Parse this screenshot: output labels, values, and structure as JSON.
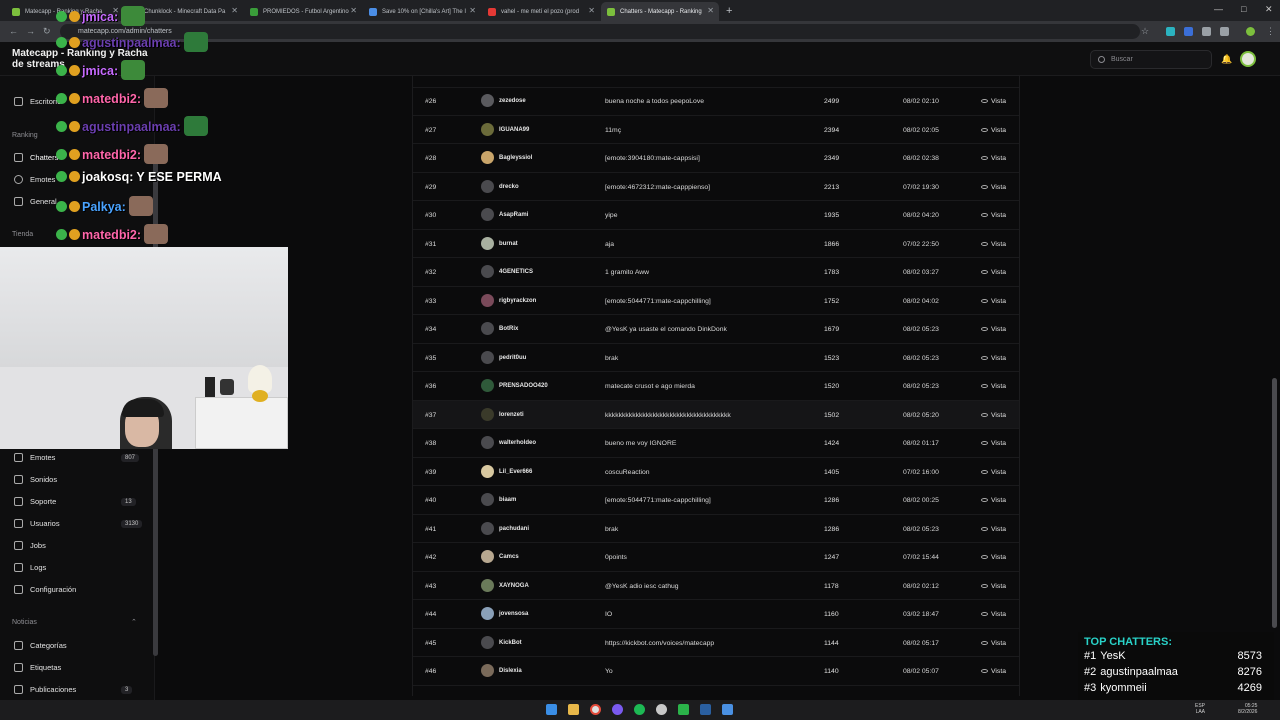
{
  "browser": {
    "tabs": [
      {
        "label": "Matecapp - Ranking y Racha",
        "color": "#7cbf3d",
        "active": false
      },
      {
        "label": "Chunklock - Minecraft Data Pa",
        "color": "#4caf50",
        "active": false
      },
      {
        "label": "PROMIEDOS - Futbol Argentino",
        "color": "#3a9d3a",
        "active": false
      },
      {
        "label": "Save 10% on [Chilla's Art] The I",
        "color": "#4b8ee6",
        "active": false
      },
      {
        "label": "vahel - me metí el pozo (prod",
        "color": "#e53935",
        "active": false
      },
      {
        "label": "Chatters - Matecapp - Ranking",
        "color": "#7cbf3d",
        "active": true
      }
    ],
    "new_tab": "+",
    "url": "matecapp.com/admin/chatters"
  },
  "header": {
    "brand": "Matecapp - Ranking y Racha de streams",
    "search_placeholder": "Buscar"
  },
  "sidebar": {
    "items_top": [
      {
        "label": "Escritorio",
        "name": "sidebar-item-escritorio"
      }
    ],
    "section_ranking": "Ranking",
    "items_ranking": [
      {
        "label": "Chatters",
        "name": "sidebar-item-chatters"
      },
      {
        "label": "Emotes",
        "name": "sidebar-item-emotes-ranking"
      },
      {
        "label": "General",
        "name": "sidebar-item-general"
      }
    ],
    "section_tienda": "Tienda",
    "items_admin": [
      {
        "label": "Emotes",
        "badge": "807",
        "name": "sidebar-item-emotes"
      },
      {
        "label": "Sonidos",
        "badge": "",
        "name": "sidebar-item-sonidos"
      },
      {
        "label": "Soporte",
        "badge": "13",
        "name": "sidebar-item-soporte"
      },
      {
        "label": "Usuarios",
        "badge": "3130",
        "name": "sidebar-item-usuarios"
      },
      {
        "label": "Jobs",
        "badge": "",
        "name": "sidebar-item-jobs"
      },
      {
        "label": "Logs",
        "badge": "",
        "name": "sidebar-item-logs"
      },
      {
        "label": "Configuración",
        "badge": "",
        "name": "sidebar-item-configuracion"
      }
    ],
    "section_noticias": "Noticias",
    "items_noticias": [
      {
        "label": "Categorías",
        "badge": "",
        "name": "sidebar-item-categorias"
      },
      {
        "label": "Etiquetas",
        "badge": "",
        "name": "sidebar-item-etiquetas"
      },
      {
        "label": "Publicaciones",
        "badge": "3",
        "name": "sidebar-item-publicaciones"
      }
    ]
  },
  "table": {
    "view_label": "Vista",
    "rows": [
      {
        "rank": "#26",
        "user": "zezedose",
        "msg": "buena noche a todos peepoLove",
        "count": "2499",
        "date": "08/02 02:10",
        "av": "#5a5a5e"
      },
      {
        "rank": "#27",
        "user": "IGUANA99",
        "msg": "11mç",
        "count": "2394",
        "date": "08/02 02:05",
        "av": "#6b6b3a"
      },
      {
        "rank": "#28",
        "user": "Bagleyssiol",
        "msg": "[emote:3904180:mate-cappsisi]",
        "count": "2349",
        "date": "08/02 02:38",
        "av": "#c9a56a"
      },
      {
        "rank": "#29",
        "user": "drecko",
        "msg": "[emote:4672312:mate-capppienso]",
        "count": "2213",
        "date": "07/02 19:30",
        "av": "#4a4a4e"
      },
      {
        "rank": "#30",
        "user": "AsapRami",
        "msg": "yipe",
        "count": "1935",
        "date": "08/02 04:20",
        "av": "#4a4a4e"
      },
      {
        "rank": "#31",
        "user": "burnat",
        "msg": "aja",
        "count": "1866",
        "date": "07/02 22:50",
        "av": "#a8b0a0"
      },
      {
        "rank": "#32",
        "user": "4GENETICS",
        "msg": "1 gramito Aww",
        "count": "1783",
        "date": "08/02 03:27",
        "av": "#4a4a4e"
      },
      {
        "rank": "#33",
        "user": "rigbyrackzon",
        "msg": "[emote:5044771:mate-cappchilling]",
        "count": "1752",
        "date": "08/02 04:02",
        "av": "#7a4a5a"
      },
      {
        "rank": "#34",
        "user": "BotRix",
        "msg": "@YesK ya usaste el comando DinkDonk",
        "count": "1679",
        "date": "08/02 05:23",
        "av": "#4a4a4e"
      },
      {
        "rank": "#35",
        "user": "pedrit0uu",
        "msg": "brak",
        "count": "1523",
        "date": "08/02 05:23",
        "av": "#4a4a4e"
      },
      {
        "rank": "#36",
        "user": "PRENSADOO420",
        "msg": "matecate crusot e ago mierda",
        "count": "1520",
        "date": "08/02 05:23",
        "av": "#2f5a3a"
      },
      {
        "rank": "#37",
        "user": "lorenzeti",
        "msg": "kkkkkkkkkkkkkkkkkkkkkkkkkkkkkkkkkkkkk",
        "count": "1502",
        "date": "08/02 05:20",
        "av": "#3a3a2a"
      },
      {
        "rank": "#38",
        "user": "walterholdeo",
        "msg": "bueno me voy IGNORE",
        "count": "1424",
        "date": "08/02 01:17",
        "av": "#4a4a4e"
      },
      {
        "rank": "#39",
        "user": "Lil_Ever666",
        "msg": "coscuReaction",
        "count": "1405",
        "date": "07/02 16:00",
        "av": "#d8c8a0"
      },
      {
        "rank": "#40",
        "user": "biaam",
        "msg": "[emote:5044771:mate-cappchilling]",
        "count": "1286",
        "date": "08/02 00:25",
        "av": "#4a4a4e"
      },
      {
        "rank": "#41",
        "user": "pachudani",
        "msg": "brak",
        "count": "1286",
        "date": "08/02 05:23",
        "av": "#4a4a4e"
      },
      {
        "rank": "#42",
        "user": "Camcs",
        "msg": "0points",
        "count": "1247",
        "date": "07/02 15:44",
        "av": "#b8a890"
      },
      {
        "rank": "#43",
        "user": "XAYNOGA",
        "msg": "@YesK adio iesc cathug",
        "count": "1178",
        "date": "08/02 02:12",
        "av": "#6a7a5a"
      },
      {
        "rank": "#44",
        "user": "jovensosa",
        "msg": "IO",
        "count": "1160",
        "date": "03/02 18:47",
        "av": "#8aa0b8"
      },
      {
        "rank": "#45",
        "user": "KickBot",
        "msg": "https://kickbot.com/voices/matecapp",
        "count": "1144",
        "date": "08/02 05:17",
        "av": "#4a4a4e"
      },
      {
        "rank": "#46",
        "user": "Dislexia",
        "msg": "Yo",
        "count": "1140",
        "date": "08/02 05:07",
        "av": "#7a6a5a"
      }
    ]
  },
  "overlay": {
    "chat": [
      {
        "user": "jmica",
        "text": "",
        "color": "#c76bff"
      },
      {
        "user": "agustinpaalmaa",
        "text": "",
        "color": "#6b3fb0"
      },
      {
        "user": "jmica",
        "text": "",
        "color": "#c76bff"
      },
      {
        "user": "matedbi2",
        "text": "",
        "color": "#ff66aa"
      },
      {
        "user": "agustinpaalmaa",
        "text": "",
        "color": "#6b3fb0"
      },
      {
        "user": "matedbi2",
        "text": "",
        "color": "#ff66aa"
      },
      {
        "user": "joakosq",
        "text": "Y ESE PERMA",
        "color": "#ffffff"
      },
      {
        "user": "Palkya",
        "text": "",
        "color": "#4aa3ff"
      },
      {
        "user": "matedbi2",
        "text": "",
        "color": "#ff66aa"
      }
    ],
    "top_chatters": {
      "title": "TOP CHATTERS:",
      "entries": [
        {
          "rank": "#1",
          "name": "YesK",
          "value": "8573"
        },
        {
          "rank": "#2",
          "name": "agustinpaalmaa",
          "value": "8276"
        },
        {
          "rank": "#3",
          "name": "kyommeii",
          "value": "4269"
        }
      ]
    }
  },
  "taskbar": {
    "lang": "ESP\nLAA",
    "time": "05:25\n8/2/2026"
  }
}
